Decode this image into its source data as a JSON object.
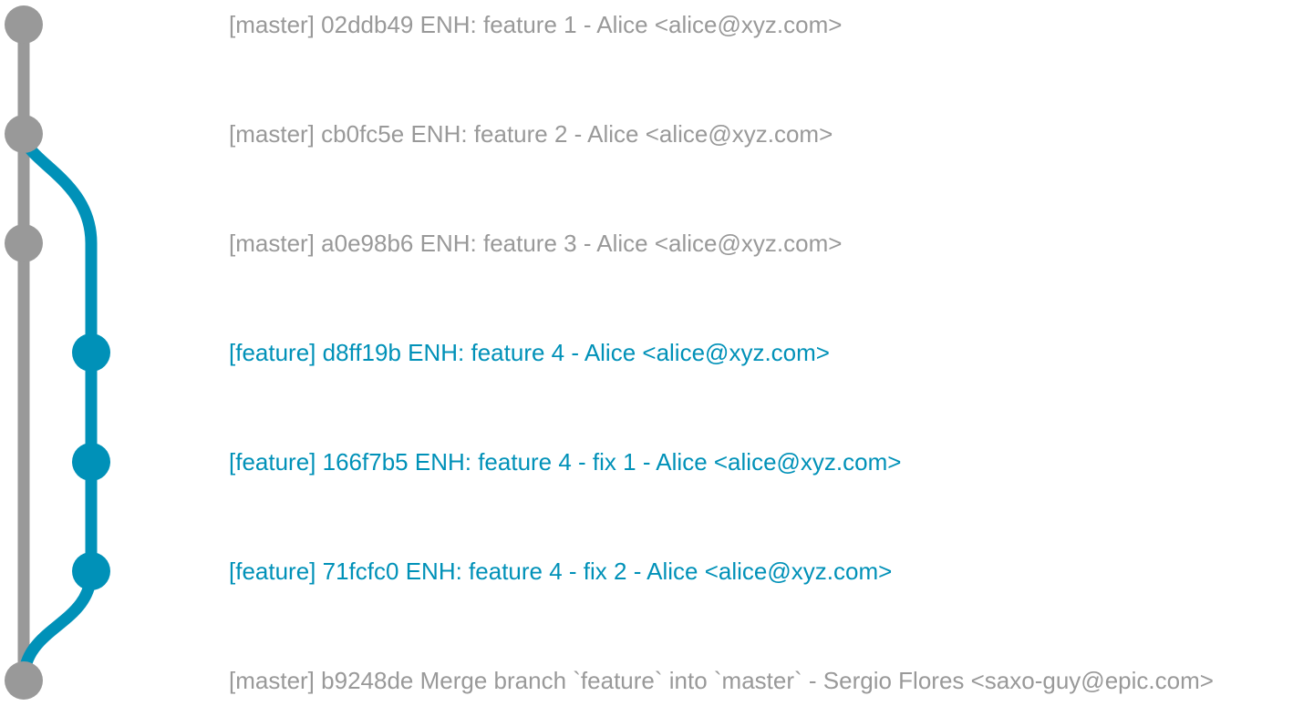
{
  "colors": {
    "master": "#999999",
    "feature": "#0091b8",
    "background": "#ffffff"
  },
  "branches": [
    "master",
    "feature"
  ],
  "commits": [
    {
      "branch": "master",
      "branch_label": "[master]",
      "hash": "02ddb49",
      "message": "ENH: feature 1",
      "author": "Alice <alice@xyz.com>"
    },
    {
      "branch": "master",
      "branch_label": "[master]",
      "hash": "cb0fc5e",
      "message": "ENH: feature 2",
      "author": "Alice <alice@xyz.com>"
    },
    {
      "branch": "master",
      "branch_label": "[master]",
      "hash": "a0e98b6",
      "message": "ENH: feature 3",
      "author": "Alice <alice@xyz.com>"
    },
    {
      "branch": "feature",
      "branch_label": "[feature]",
      "hash": "d8ff19b",
      "message": "ENH: feature 4",
      "author": "Alice <alice@xyz.com>"
    },
    {
      "branch": "feature",
      "branch_label": "[feature]",
      "hash": "166f7b5",
      "message": "ENH: feature 4 - fix 1",
      "author": "Alice <alice@xyz.com>"
    },
    {
      "branch": "feature",
      "branch_label": "[feature]",
      "hash": "71fcfc0",
      "message": "ENH: feature 4 - fix 2",
      "author": "Alice <alice@xyz.com>"
    },
    {
      "branch": "master",
      "branch_label": "[master]",
      "hash": "b9248de",
      "message": "Merge branch `feature` into `master`",
      "author": "Sergio Flores <saxo-guy@epic.com>"
    }
  ],
  "edges": [
    {
      "from": 0,
      "to": 1,
      "branch": "master"
    },
    {
      "from": 1,
      "to": 2,
      "branch": "master"
    },
    {
      "from": 2,
      "to": 6,
      "branch": "master"
    },
    {
      "from": 1,
      "to": 3,
      "branch": "feature"
    },
    {
      "from": 3,
      "to": 4,
      "branch": "feature"
    },
    {
      "from": 4,
      "to": 5,
      "branch": "feature"
    },
    {
      "from": 5,
      "to": 6,
      "branch": "feature"
    }
  ]
}
